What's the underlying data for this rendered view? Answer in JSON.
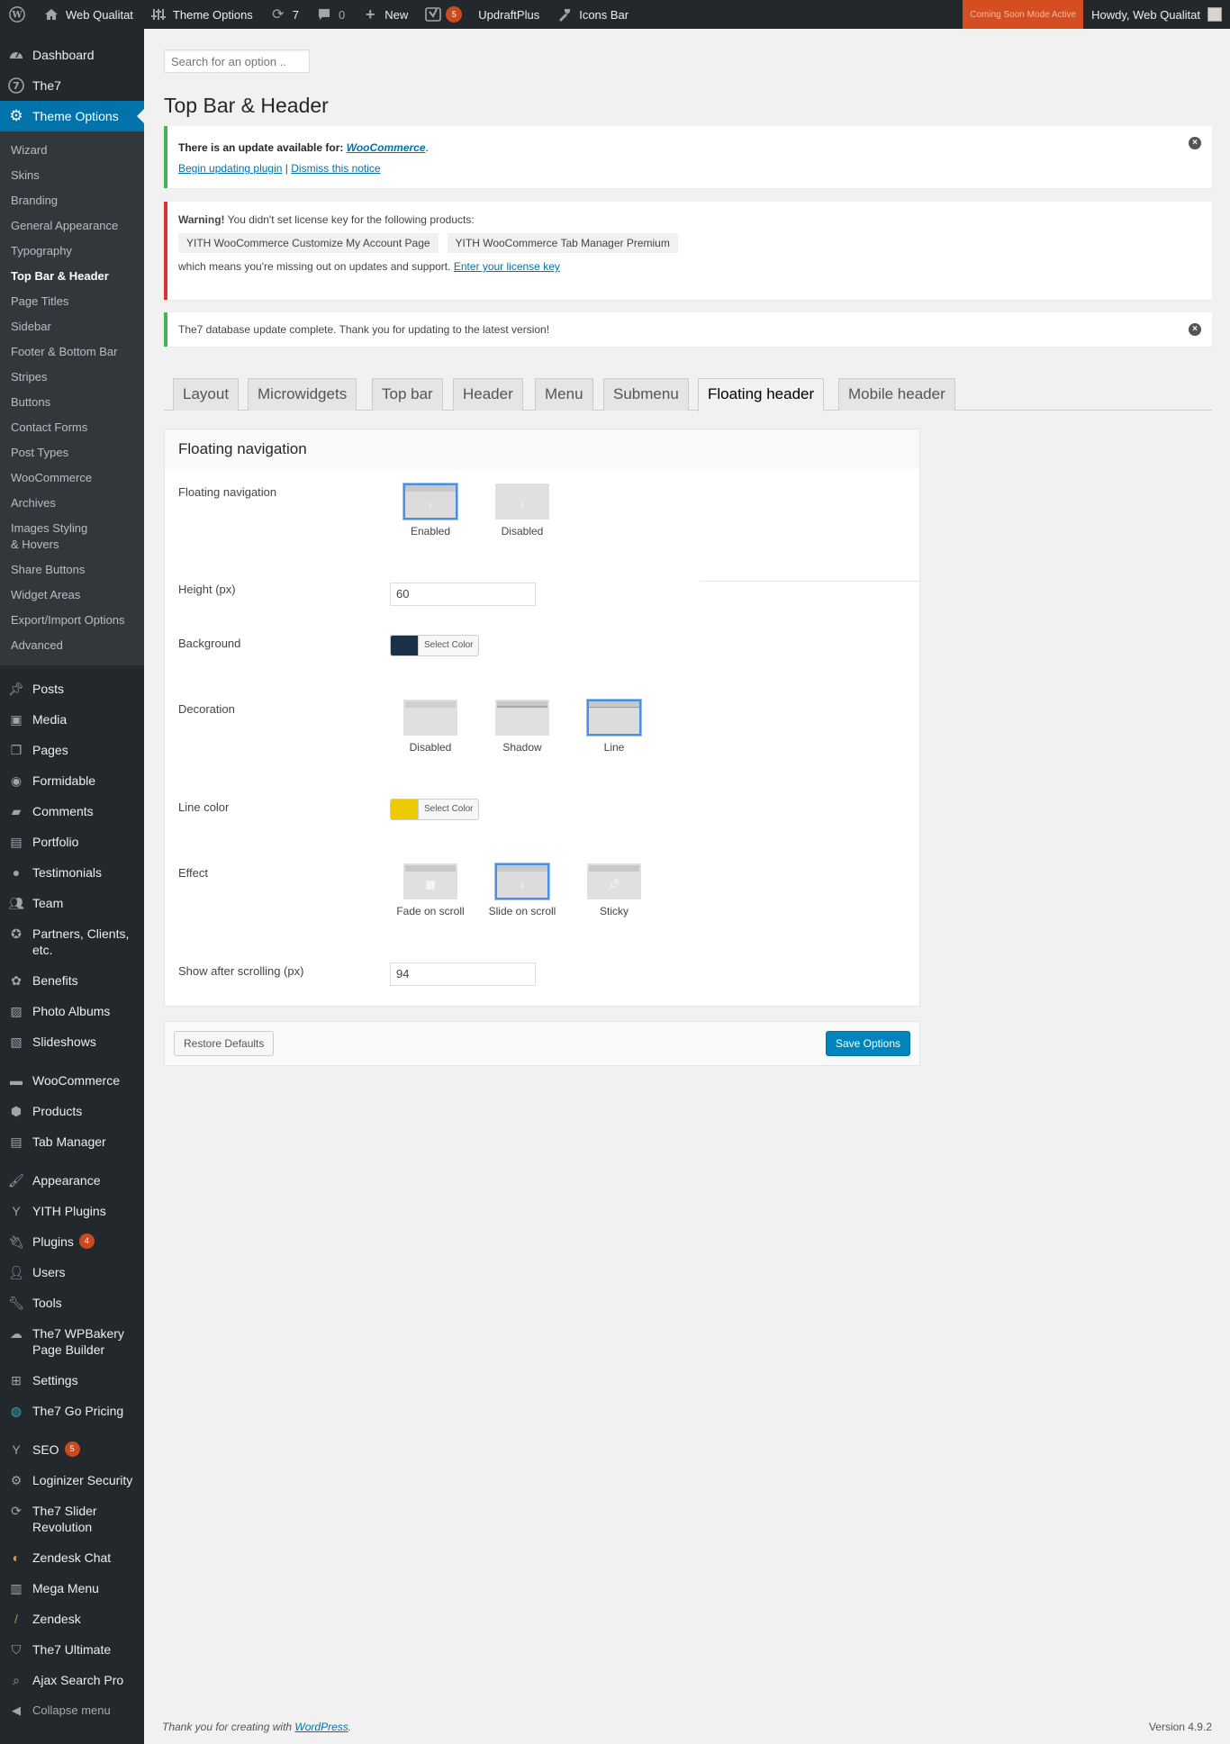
{
  "adminbar": {
    "site_name": "Web Qualitat",
    "theme_options": "Theme Options",
    "updates_count": "7",
    "comments_count": "0",
    "new_label": "New",
    "yoast_count": "5",
    "updraft": "UpdraftPlus",
    "icons_bar": "Icons Bar",
    "coming_soon": "Coming Soon Mode Active",
    "howdy": "Howdy, Web Qualitat"
  },
  "sidebar": {
    "top_items": [
      {
        "label": "Dashboard",
        "icon": "dashboard-icon"
      },
      {
        "label": "The7",
        "icon": "the7-icon"
      },
      {
        "label": "Theme Options",
        "icon": "gear-icon"
      }
    ],
    "submenu": [
      "Wizard",
      "Skins",
      "Branding",
      "General Appearance",
      "Typography",
      "Top Bar & Header",
      "Page Titles",
      "Sidebar",
      "Footer & Bottom Bar",
      "Stripes",
      "Buttons",
      "Contact Forms",
      "Post Types",
      "WooCommerce",
      "Archives",
      "Images Styling & Hovers",
      "Share Buttons",
      "Widget Areas",
      "Export/Import Options",
      "Advanced"
    ],
    "group1": [
      "Posts",
      "Media",
      "Pages",
      "Formidable",
      "Comments",
      "Portfolio",
      "Testimonials",
      "Team",
      "Partners, Clients, etc.",
      "Benefits",
      "Photo Albums",
      "Slideshows"
    ],
    "group2": [
      "WooCommerce",
      "Products",
      "Tab Manager"
    ],
    "group3": [
      "Appearance",
      "YITH Plugins",
      "Plugins",
      "Users",
      "Tools",
      "The7 WPBakery Page Builder",
      "Settings",
      "The7 Go Pricing"
    ],
    "plugins_count": "4",
    "group4": [
      "SEO",
      "Loginizer Security",
      "The7 Slider Revolution",
      "Zendesk Chat",
      "Mega Menu",
      "Zendesk",
      "The7 Ultimate",
      "Ajax Search Pro"
    ],
    "seo_count": "5",
    "collapse": "Collapse menu"
  },
  "search": {
    "placeholder": "Search for an option .."
  },
  "page_title": "Top Bar & Header",
  "notice_update": {
    "text": "There is an update available for: ",
    "plugin": "WooCommerce",
    "link_begin": "Begin updating plugin",
    "sep": " | ",
    "link_dismiss": "Dismiss this notice"
  },
  "notice_warning": {
    "strong": "Warning!",
    "text": " You didn't set license key for the following products:",
    "products": [
      "YITH WooCommerce Customize My Account Page",
      "YITH WooCommerce Tab Manager Premium"
    ],
    "footer": "which means you're missing out on updates and support. ",
    "link": "Enter your license key"
  },
  "notice_db": {
    "text": "The7 database update complete. Thank you for updating to the latest version!"
  },
  "tabs": [
    "Layout",
    "Microwidgets",
    "Top bar",
    "Header",
    "Menu",
    "Submenu",
    "Floating header",
    "Mobile header"
  ],
  "panel": {
    "title": "Floating navigation",
    "floating_nav": {
      "label": "Floating navigation",
      "options": [
        "Enabled",
        "Disabled"
      ],
      "selected": "Enabled"
    },
    "height": {
      "label": "Height (px)",
      "value": "60"
    },
    "background": {
      "label": "Background",
      "color": "#1b3147",
      "button": "Select Color"
    },
    "decoration": {
      "label": "Decoration",
      "options": [
        "Disabled",
        "Shadow",
        "Line"
      ],
      "selected": "Line"
    },
    "line_color": {
      "label": "Line color",
      "color": "#eecb00",
      "button": "Select Color"
    },
    "effect": {
      "label": "Effect",
      "options": [
        "Fade on scroll",
        "Slide on scroll",
        "Sticky"
      ],
      "selected": "Slide on scroll"
    },
    "show_after": {
      "label": "Show after scrolling (px)",
      "value": "94"
    }
  },
  "actions": {
    "restore": "Restore Defaults",
    "save": "Save Options"
  },
  "footer": {
    "text": "Thank you for creating with ",
    "link": "WordPress",
    "end": ".",
    "version": "Version 4.9.2"
  }
}
